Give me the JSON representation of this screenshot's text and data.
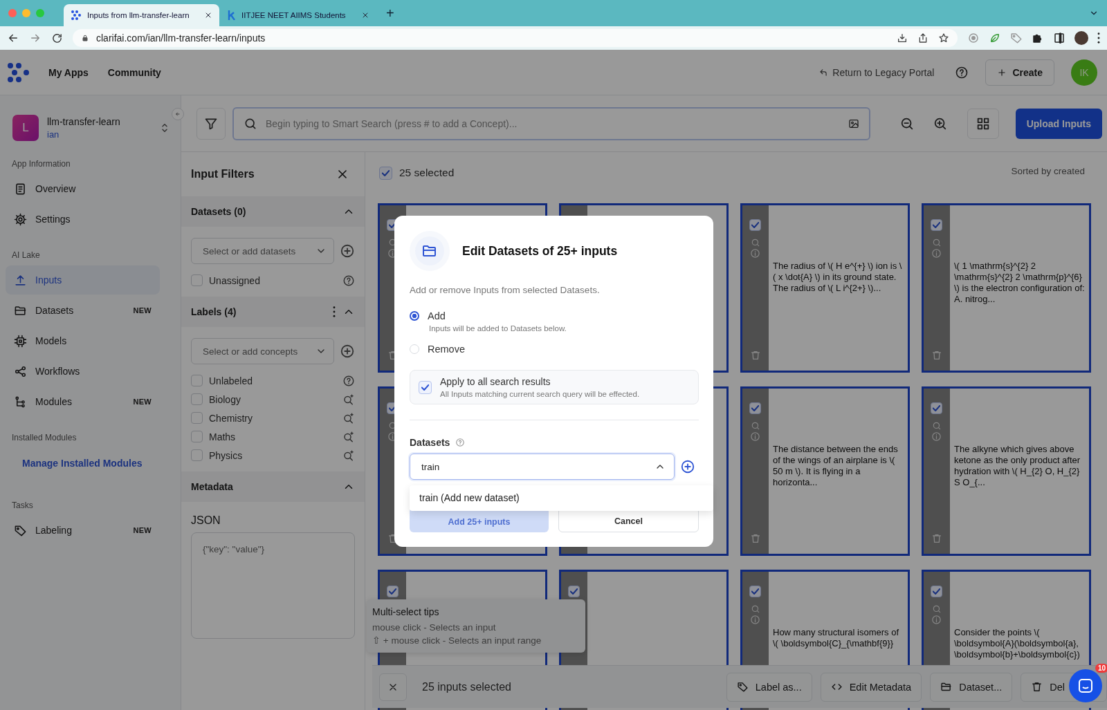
{
  "browser": {
    "tabs": [
      {
        "title": "Inputs from llm-transfer-learn",
        "selected": true
      },
      {
        "title": "IITJEE NEET AIIMS Students",
        "selected": false
      }
    ],
    "new_tab": "+",
    "url": "clarifai.com/ian/llm-transfer-learn/inputs"
  },
  "header": {
    "nav": [
      "My Apps",
      "Community"
    ],
    "legacy_link": "Return to Legacy Portal",
    "create_button": "Create",
    "avatar": "IK"
  },
  "sidebar": {
    "app": {
      "initial": "L",
      "name": "llm-transfer-learn",
      "owner": "ian"
    },
    "sections": [
      {
        "title": "App Information",
        "items": [
          {
            "label": "Overview",
            "kind": "nav",
            "selected": false
          },
          {
            "label": "Settings",
            "kind": "nav",
            "selected": false
          }
        ]
      },
      {
        "title": "AI Lake",
        "items": [
          {
            "label": "Inputs",
            "kind": "nav",
            "selected": true
          },
          {
            "label": "Datasets",
            "kind": "nav",
            "selected": false,
            "badge": "NEW"
          },
          {
            "label": "Models",
            "kind": "nav",
            "selected": false
          },
          {
            "label": "Workflows",
            "kind": "nav",
            "selected": false
          },
          {
            "label": "Modules",
            "kind": "nav",
            "selected": false,
            "badge": "NEW"
          }
        ]
      },
      {
        "title": "Installed Modules",
        "items": [
          {
            "label": "Manage Installed Modules",
            "kind": "link"
          }
        ]
      },
      {
        "title": "Tasks",
        "items": [
          {
            "label": "Labeling",
            "kind": "nav",
            "selected": false,
            "badge": "NEW"
          }
        ]
      }
    ]
  },
  "toolbar": {
    "search_placeholder": "Begin typing to Smart Search (press # to add a Concept)...",
    "upload_button": "Upload Inputs"
  },
  "filters": {
    "title": "Input Filters",
    "datasets": {
      "title": "Datasets (0)",
      "expanded": true,
      "placeholder": "Select or add datasets",
      "options": [
        {
          "label": "Unassigned",
          "kind": "special",
          "checked": false
        }
      ]
    },
    "labels": {
      "title": "Labels (4)",
      "expanded": true,
      "placeholder": "Select or add concepts",
      "options": [
        {
          "label": "Unlabeled",
          "kind": "special",
          "checked": false
        },
        {
          "label": "Biology",
          "kind": "concept",
          "checked": false
        },
        {
          "label": "Chemistry",
          "kind": "concept",
          "checked": false
        },
        {
          "label": "Maths",
          "kind": "concept",
          "checked": false
        },
        {
          "label": "Physics",
          "kind": "concept",
          "checked": false
        }
      ]
    },
    "metadata": {
      "title": "Metadata",
      "expanded": true,
      "field_label": "JSON",
      "placeholder": "{\"key\": \"value\"}"
    }
  },
  "grid": {
    "select_all": {
      "label": "25 selected",
      "checked": true
    },
    "sort": "Sorted by created",
    "cards": [
      {
        "selected": true
      },
      {
        "selected": true
      },
      {
        "selected": true,
        "text": "The radius of \\( H e^{+} \\) ion is \\( x \\dot{A} \\) in its ground state. The radius of \\( L i^{2+} \\)..."
      },
      {
        "selected": true,
        "text": "\\( 1 \\mathrm{s}^{2} 2 \\mathrm{s}^{2} 2 \\mathrm{p}^{6} \\) is the electron configuration of: A. nitrog..."
      },
      {
        "selected": true
      },
      {
        "selected": true
      },
      {
        "selected": true,
        "text": "The distance between the ends of the wings of an airplane is \\( 50 m \\). It is flying in a horizonta..."
      },
      {
        "selected": true,
        "text": "The alkyne which gives above ketone as the only product after hydration with \\( H_{2} O, H_{2} S O_{..."
      },
      {
        "selected": true
      },
      {
        "selected": true
      },
      {
        "selected": true,
        "text": "How many structural isomers of \\( \\boldsymbol{C}_{\\mathbf{9}}"
      },
      {
        "selected": true,
        "text": "Consider the points \\( \\boldsymbol{A}(\\boldsymbol{a}, \\boldsymbol{b}+\\boldsymbol{c})"
      }
    ]
  },
  "tips": {
    "title": "Multi-select tips",
    "lines": [
      "mouse click - Selects an input",
      "⇧ + mouse click - Selects an input range"
    ]
  },
  "action_bar": {
    "count": "25 inputs selected",
    "actions": [
      "Label as...",
      "Edit Metadata",
      "Dataset...",
      "Del"
    ]
  },
  "chat": {
    "badge": "10"
  },
  "modal": {
    "title": "Edit Datasets of 25+ inputs",
    "description": "Add or remove Inputs from selected Datasets.",
    "modes": [
      {
        "label": "Add",
        "hint": "Inputs will be added to Datasets below.",
        "selected": true
      },
      {
        "label": "Remove",
        "selected": false
      }
    ],
    "apply_all": {
      "label": "Apply to all search results",
      "hint": "All Inputs matching current search query will be effected.",
      "checked": true
    },
    "datasets_label": "Datasets",
    "datasets_value": "train",
    "expanded": true,
    "suggestions": [
      "train (Add new dataset)"
    ],
    "confirm_button": {
      "label": "Add 25+ inputs",
      "disabled": true
    },
    "cancel_button": "Cancel"
  }
}
